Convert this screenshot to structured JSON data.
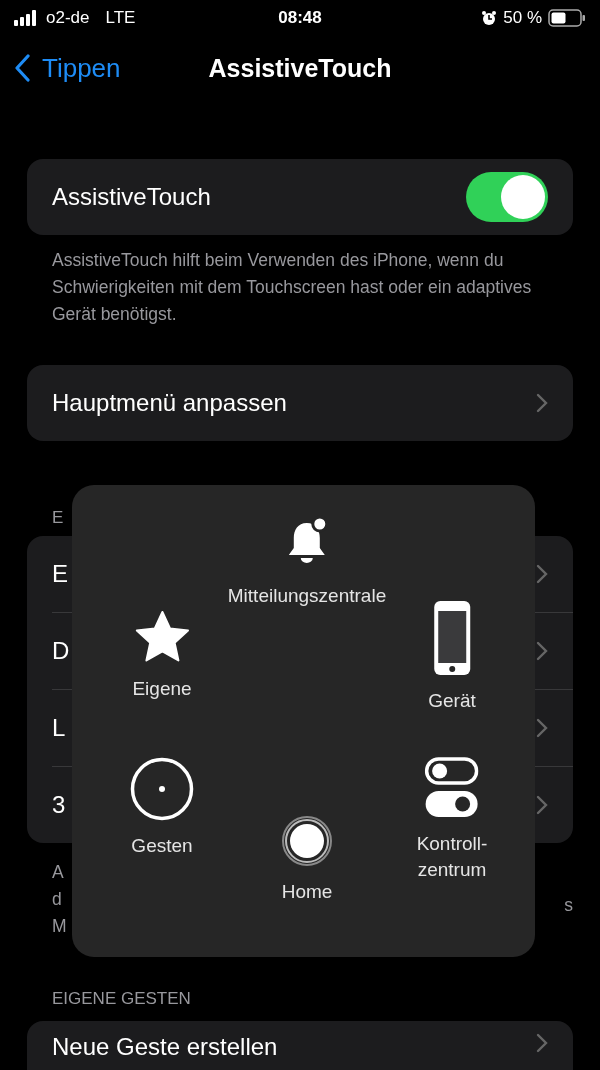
{
  "status_bar": {
    "carrier": "o2-de",
    "network": "LTE",
    "time": "08:48",
    "battery": "50 %"
  },
  "nav": {
    "back": "Tippen",
    "title": "AssistiveTouch"
  },
  "toggle_card": {
    "label": "AssistiveTouch",
    "on": true
  },
  "toggle_footer": "AssistiveTouch hilft beim Verwenden des iPhone, wenn du Schwierigkeiten mit dem Touchscreen hast oder ein adaptives Gerät benötigst.",
  "menu_card": {
    "label": "Hauptmenü anpassen"
  },
  "section_header": "E",
  "rows": [
    {
      "label": "E"
    },
    {
      "label": "D"
    },
    {
      "label": "L"
    },
    {
      "label": "3"
    }
  ],
  "footnote_left": [
    "A",
    "d",
    "M"
  ],
  "footnote_right": [
    "s"
  ],
  "gestures_header": "EIGENE GESTEN",
  "gestures_row": {
    "label": "Neue Geste erstellen"
  },
  "menu_overlay": {
    "items": [
      {
        "kind": "notifications",
        "label": "Mitteilungszentrale"
      },
      {
        "kind": "custom",
        "label": "Eigene"
      },
      {
        "kind": "device",
        "label": "Gerät"
      },
      {
        "kind": "gestures",
        "label": "Gesten"
      },
      {
        "kind": "control",
        "label": "Kontroll-\nzentrum"
      },
      {
        "kind": "home",
        "label": "Home"
      }
    ]
  }
}
